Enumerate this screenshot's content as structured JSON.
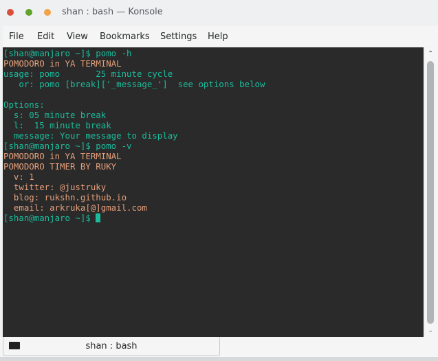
{
  "window": {
    "title": "shan : bash — Konsole",
    "controls": [
      "close",
      "maximize",
      "minimize"
    ]
  },
  "menubar": {
    "items": [
      "File",
      "Edit",
      "View",
      "Bookmarks",
      "Settings",
      "Help"
    ]
  },
  "terminal": {
    "lines": [
      {
        "text": "[shan@manjaro ~]$ pomo -h",
        "color": "teal"
      },
      {
        "text": "POMODORO in YA TERMINAL",
        "color": "orange"
      },
      {
        "text": "usage: pomo       25 minute cycle",
        "color": "teal"
      },
      {
        "text": "   or: pomo [break]['_message_']  see options below",
        "color": "teal"
      },
      {
        "text": "",
        "color": "teal"
      },
      {
        "text": "Options:",
        "color": "teal"
      },
      {
        "text": "  s: 05 minute break",
        "color": "teal"
      },
      {
        "text": "  l:  15 minute break",
        "color": "teal"
      },
      {
        "text": "  message: Your message to display",
        "color": "teal"
      },
      {
        "text": "[shan@manjaro ~]$ pomo -v",
        "color": "teal"
      },
      {
        "text": "POMODORO in YA TERMINAL",
        "color": "orange"
      },
      {
        "text": "POMODORO TIMER BY RUKY",
        "color": "orange"
      },
      {
        "text": "  v: 1",
        "color": "orange"
      },
      {
        "text": "  twitter: @justruky",
        "color": "orange"
      },
      {
        "text": "  blog: rukshn.github.io",
        "color": "orange"
      },
      {
        "text": "  email: arkruka[@]gmail.com",
        "color": "orange"
      }
    ],
    "prompt": "[shan@manjaro ~]$ ",
    "colors": {
      "teal": "#1abc9c",
      "orange": "#e7a07b",
      "background": "#2a2a2a"
    }
  },
  "scrollbar": {
    "up_icon": "chevron-up-icon",
    "down_icon": "chevron-down-icon"
  },
  "tabs": [
    {
      "label": "shan : bash",
      "icon": "terminal-icon"
    }
  ]
}
